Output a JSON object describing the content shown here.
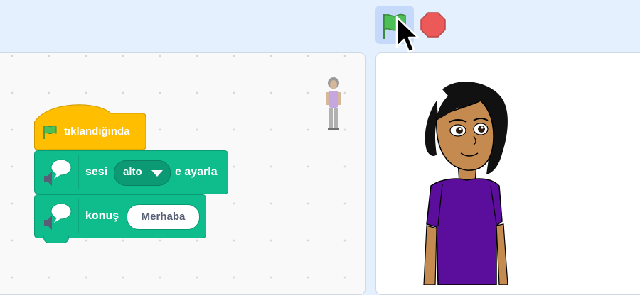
{
  "toolbar": {
    "green_flag": "green-flag-icon",
    "stop": "stop-icon"
  },
  "code": {
    "hat_block_label": "tıklandığında",
    "block1": {
      "text1": "sesi",
      "dropdown_value": "alto",
      "text2": "e ayarla"
    },
    "block2": {
      "text1": "konuş",
      "input_value": "Merhaba"
    }
  },
  "colors": {
    "event": "#ffbf00",
    "text2speech": "#0fbd8c",
    "stop": "#ec5959"
  }
}
